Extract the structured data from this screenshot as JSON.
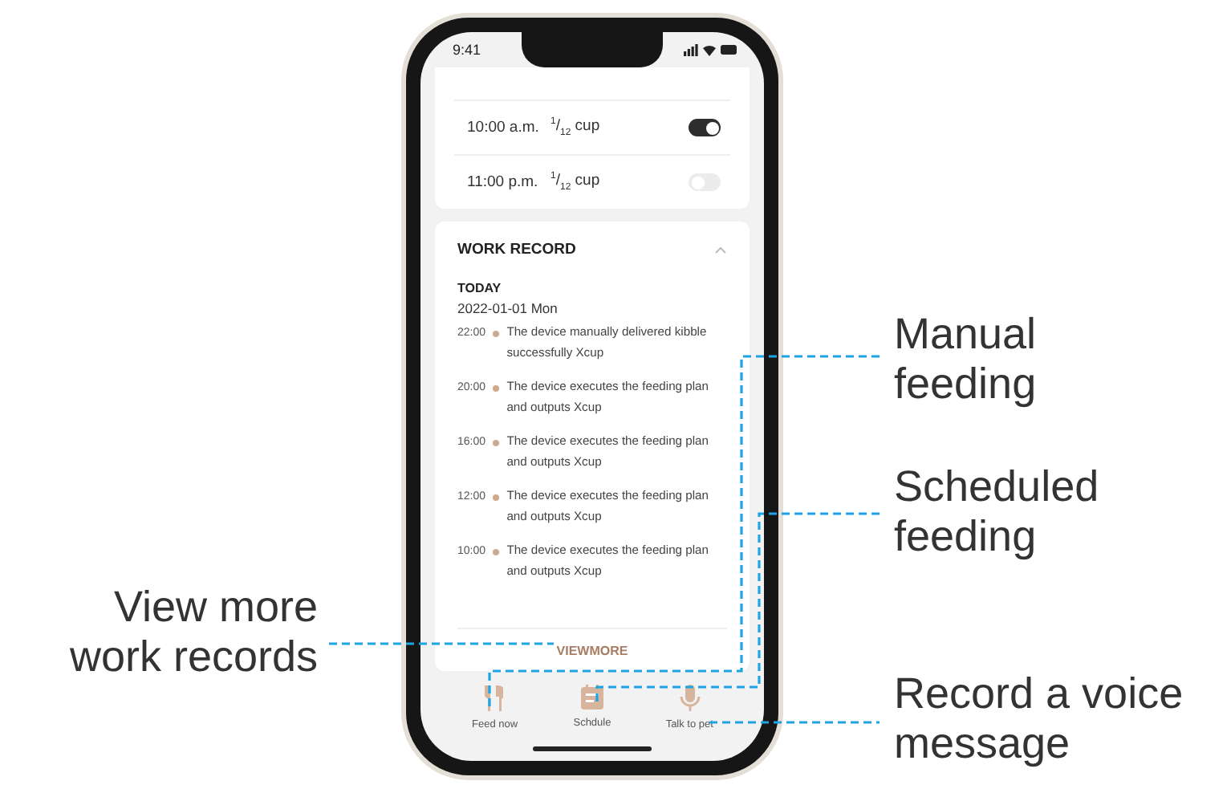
{
  "status_bar": {
    "time": "9:41"
  },
  "feeding_plans": [
    {
      "time": "10:00 a.m.",
      "portion": "$^{1}$/$_{12}$ cup",
      "on": true
    },
    {
      "time": "11:00 p.m.",
      "portion": "$^{1}$/$_{12}$ cup",
      "on": false
    }
  ],
  "work_record": {
    "title": "WORK RECORD",
    "expanded": true,
    "day": "TODAY",
    "date": "2022-01-01 Mon",
    "entries": [
      {
        "time": "22:00",
        "text": "The device manually delivered kibble successfully Xcup"
      },
      {
        "time": "20:00",
        "text": "The device executes the feeding plan and outputs Xcup"
      },
      {
        "time": "16:00",
        "text": "The device executes the feeding plan and outputs Xcup"
      },
      {
        "time": "12:00",
        "text": "The device executes the feeding plan and outputs Xcup"
      },
      {
        "time": "10:00",
        "text": "The device executes the feeding plan and outputs Xcup"
      }
    ],
    "view_more": "VIEWMORE"
  },
  "nav": [
    {
      "label": "Feed now",
      "kind": "feed"
    },
    {
      "label": "Schdule",
      "kind": "schedule"
    },
    {
      "label": "Talk to pet",
      "kind": "talk"
    }
  ],
  "callouts": [
    {
      "text": "Manual feeding",
      "kind": "manual"
    },
    {
      "text": "Scheduled feeding",
      "kind": "scheduled"
    },
    {
      "text": "View more work records",
      "kind": "viewmore"
    },
    {
      "text": "Record a voice message",
      "kind": "voice"
    }
  ]
}
